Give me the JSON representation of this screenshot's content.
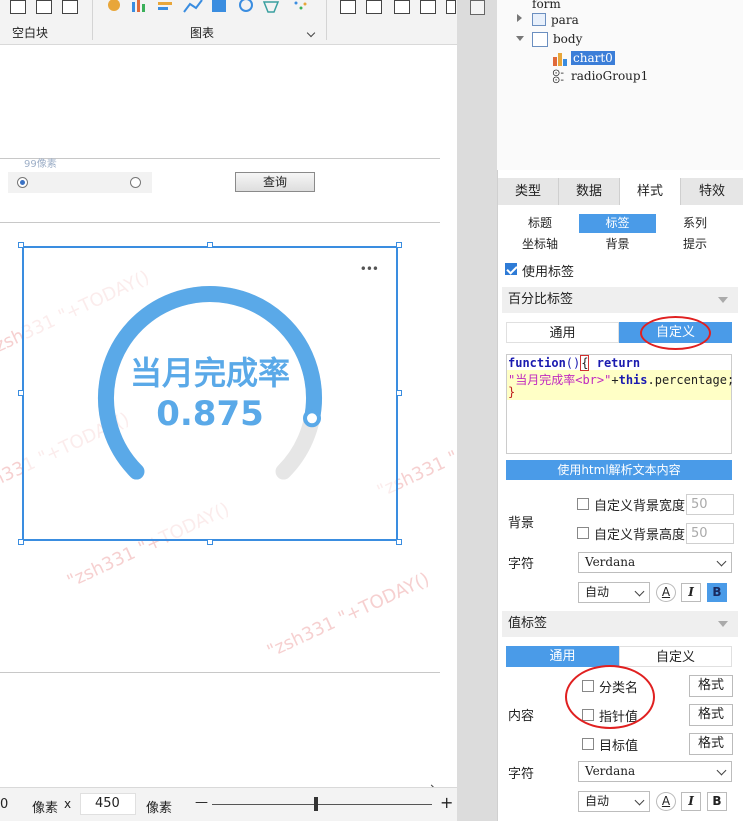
{
  "toolbar": {
    "group_blank_label": "空白块",
    "group_chart_label": "图表"
  },
  "canvas": {
    "size_hint": "99像素",
    "query_button": "查询",
    "chart_title": "当月完成率",
    "chart_value": "0.875",
    "watermark": "\"zsh331 \"+TODAY()",
    "more_icon": "•••"
  },
  "statusbar": {
    "left_value": "0",
    "unit_px": "像素",
    "x_sep": "x",
    "height_value": "450",
    "unit_px2": "像素",
    "minus": "—",
    "plus": "+"
  },
  "tree": {
    "items": [
      {
        "label": "form"
      },
      {
        "label": "para"
      },
      {
        "label": "body"
      },
      {
        "label": "chart0"
      },
      {
        "label": "radioGroup1"
      }
    ]
  },
  "tabs": [
    "类型",
    "数据",
    "样式",
    "特效"
  ],
  "subtabs_row1": [
    "标题",
    "标签",
    "系列"
  ],
  "subtabs_row2": [
    "坐标轴",
    "背景",
    "提示"
  ],
  "use_label": "使用标签",
  "percent_section": {
    "title": "百分比标签",
    "mode_general": "通用",
    "mode_custom": "自定义",
    "code_line1_kw": "function",
    "code_line1_paren": "()",
    "code_line1_brace": "{",
    "code_line1_return": "return",
    "code_line2_str": "\"当月完成率<br>\"",
    "code_line2_plus": "+",
    "code_line2_this": "this",
    "code_line2_prop": ".percentage;",
    "code_line3": "}",
    "html_parse_button": "使用html解析文本内容",
    "bg_label": "背景",
    "bg_width_label": "自定义背景宽度",
    "bg_width_value": "50",
    "bg_height_label": "自定义背景高度",
    "bg_height_value": "50",
    "font_label": "字符",
    "font_value": "Verdana",
    "size_value": "自动",
    "btn_a": "A",
    "btn_i": "I",
    "btn_b": "B"
  },
  "value_section": {
    "title": "值标签",
    "mode_general": "通用",
    "mode_custom": "自定义",
    "content_label": "内容",
    "opt_category": "分类名",
    "opt_pointer": "指针值",
    "opt_target": "目标值",
    "format_label": "格式",
    "font_label": "字符",
    "font_value": "Verdana",
    "size_value": "自动",
    "btn_a": "A",
    "btn_i": "I",
    "btn_b": "B"
  },
  "gauge": {
    "percentage": 0.875,
    "track_color": "#e6e6e6",
    "value_color": "#5aa9e8"
  },
  "colors": {
    "accent": "#4a9be8",
    "highlight_red": "#e02020"
  }
}
